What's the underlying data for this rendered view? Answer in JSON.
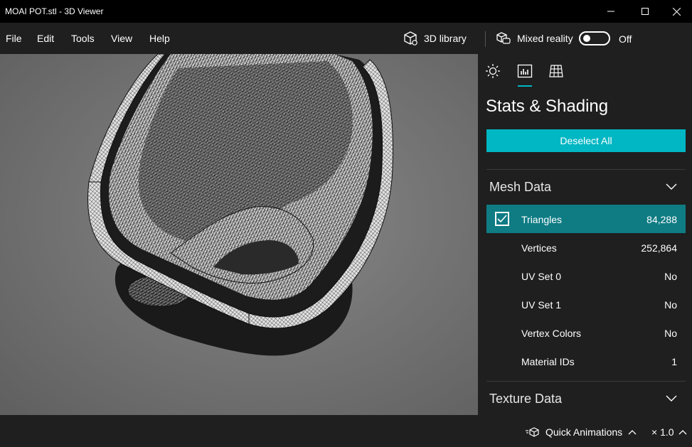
{
  "window": {
    "title": "MOAI POT.stl - 3D Viewer"
  },
  "menu": {
    "items": [
      "File",
      "Edit",
      "Tools",
      "View",
      "Help"
    ],
    "library_label": "3D library",
    "mixed_reality_label": "Mixed reality",
    "toggle_state_label": "Off"
  },
  "panel": {
    "title": "Stats & Shading",
    "deselect_label": "Deselect All",
    "mesh_section": "Mesh Data",
    "texture_section": "Texture Data",
    "rows": [
      {
        "label": "Triangles",
        "value": "84,288",
        "selected": true
      },
      {
        "label": "Vertices",
        "value": "252,864",
        "selected": false
      },
      {
        "label": "UV Set 0",
        "value": "No",
        "selected": false
      },
      {
        "label": "UV Set 1",
        "value": "No",
        "selected": false
      },
      {
        "label": "Vertex Colors",
        "value": "No",
        "selected": false
      },
      {
        "label": "Material IDs",
        "value": "1",
        "selected": false
      }
    ]
  },
  "status": {
    "quick_animations_label": "Quick Animations",
    "speed_label": "× 1.0"
  },
  "colors": {
    "accent": "#00b7c3",
    "selected_row": "#0f7c84",
    "chrome": "#1f1f1f"
  }
}
